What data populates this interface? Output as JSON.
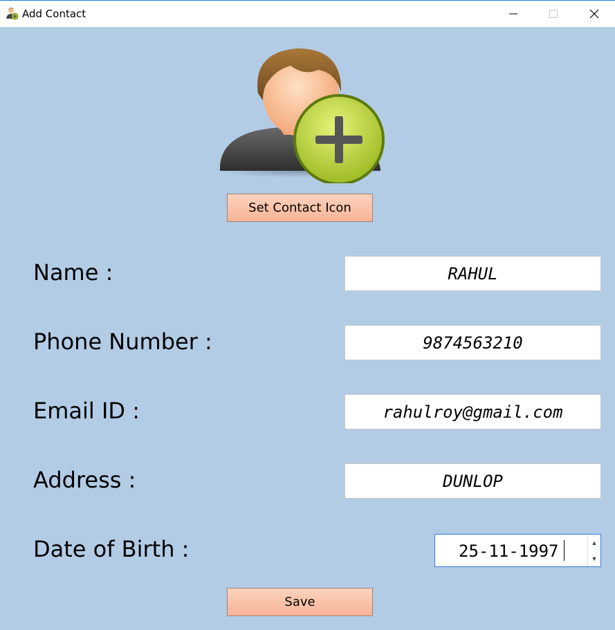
{
  "window": {
    "title": "Add Contact",
    "controls": {
      "minimize": "minimize-icon",
      "maximize": "maximize-icon",
      "close": "close-icon"
    }
  },
  "avatar": {
    "icon": "add-contact-icon",
    "badge_color": "#a8c830",
    "plus_color": "#555555"
  },
  "buttons": {
    "set_icon_label": "Set Contact Icon",
    "save_label": "Save"
  },
  "form": {
    "name_label": "Name :",
    "name_value": "RAHUL",
    "phone_label": "Phone Number :",
    "phone_value": "9874563210",
    "email_label": "Email ID :",
    "email_value": "rahulroy@gmail.com",
    "address_label": "Address :",
    "address_value": "DUNLOP",
    "dob_label": "Date of Birth :",
    "dob_value": "25-11-1997"
  },
  "colors": {
    "background": "#b3cce6",
    "button": "#f7b497",
    "field_focus_border": "#2f7ad0"
  }
}
